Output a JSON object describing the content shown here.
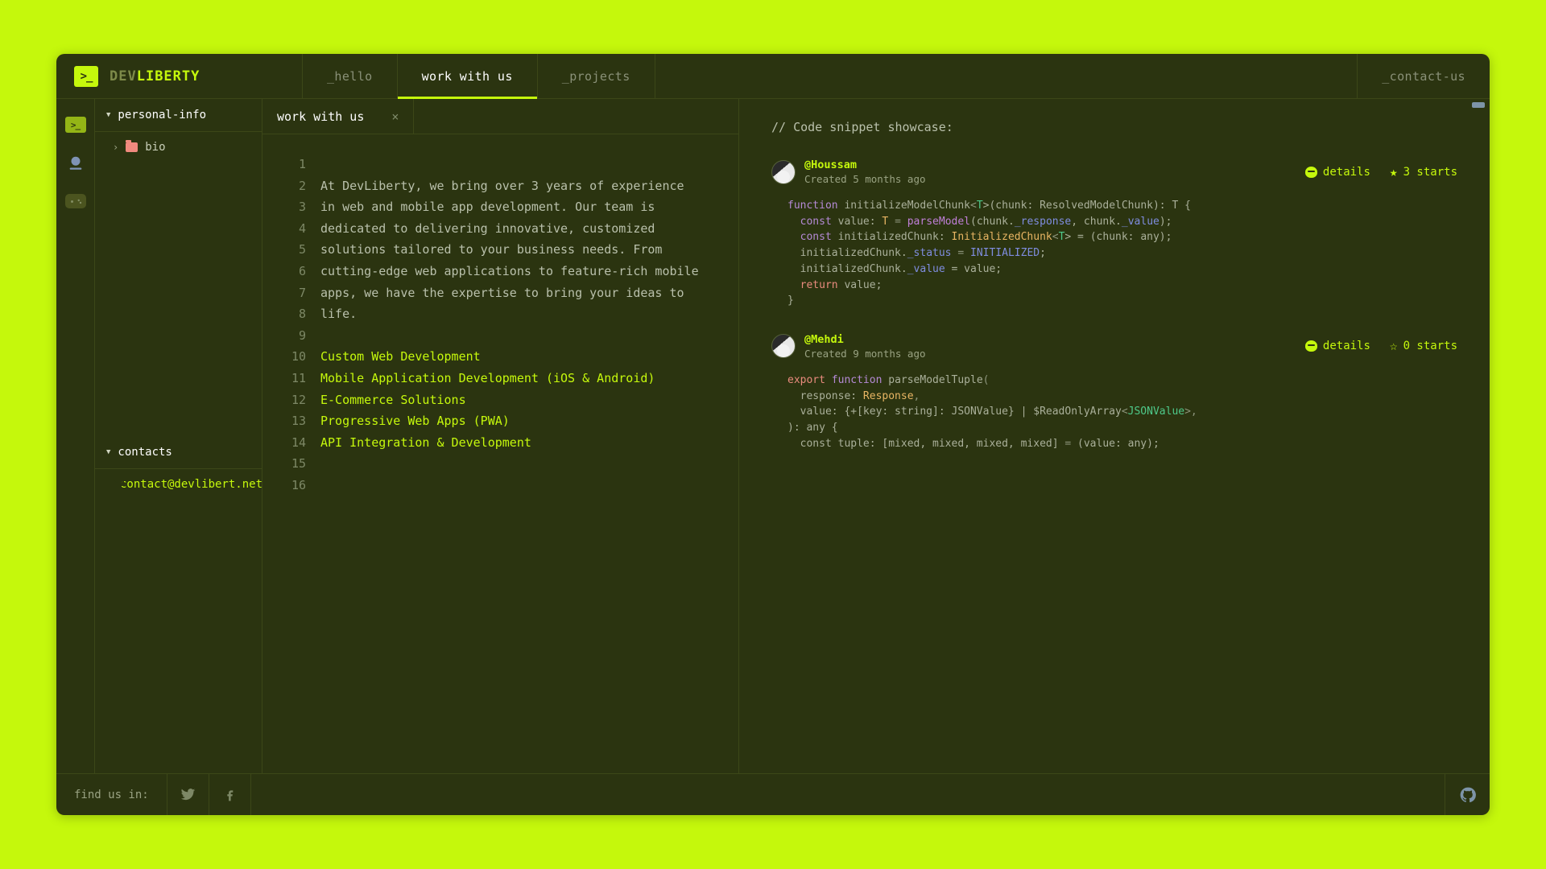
{
  "header": {
    "brand_dim": "DEV",
    "brand_lit": "LIBERTY",
    "logo_glyph": ">_",
    "tabs": [
      {
        "label": "_hello",
        "active": false
      },
      {
        "label": "work with us",
        "active": true
      },
      {
        "label": "_projects",
        "active": false
      }
    ],
    "right_tab": "_contact-us"
  },
  "iconbar": {
    "terminal_glyph": ">_",
    "items": [
      "terminal-icon",
      "user-icon",
      "gamepad-icon"
    ]
  },
  "explorer": {
    "section_personal": "personal-info",
    "item_bio": "bio",
    "section_contacts": "contacts",
    "email": "contact@devlibert.net"
  },
  "editor": {
    "tab_label": "work with us",
    "close_glyph": "×",
    "lines": [
      {
        "n": "1",
        "text": "",
        "highlight": false
      },
      {
        "n": "2",
        "text": "At DevLiberty, we bring over 3 years of experience",
        "highlight": false
      },
      {
        "n": "3",
        "text": "in web and mobile app development. Our team is",
        "highlight": false
      },
      {
        "n": "4",
        "text": "dedicated to delivering innovative, customized",
        "highlight": false
      },
      {
        "n": "5",
        "text": "solutions tailored to your business needs. From",
        "highlight": false
      },
      {
        "n": "6",
        "text": "cutting-edge web applications to feature-rich mobile",
        "highlight": false
      },
      {
        "n": "7",
        "text": "apps, we have the expertise to bring your ideas to",
        "highlight": false
      },
      {
        "n": "8",
        "text": "life.",
        "highlight": false
      },
      {
        "n": "9",
        "text": "",
        "highlight": false
      },
      {
        "n": "10",
        "text": "Custom Web Development",
        "highlight": true
      },
      {
        "n": "11",
        "text": "Mobile Application Development (iOS & Android)",
        "highlight": true
      },
      {
        "n": "12",
        "text": "E-Commerce Solutions",
        "highlight": true
      },
      {
        "n": "13",
        "text": "Progressive Web Apps (PWA)",
        "highlight": true
      },
      {
        "n": "14",
        "text": "API Integration & Development",
        "highlight": true
      },
      {
        "n": "15",
        "text": "",
        "highlight": false
      },
      {
        "n": "16",
        "text": "",
        "highlight": false
      }
    ]
  },
  "snippets": {
    "title": "// Code snippet showcase:",
    "details_label": "details",
    "cards": [
      {
        "user": "@Houssam",
        "created": "Created 5 months ago",
        "stars_label": "3 starts",
        "star_glyph": "★",
        "code": [
          [
            {
              "t": "function ",
              "c": "kw"
            },
            {
              "t": "initializeModelChunk",
              "c": "plain"
            },
            {
              "t": "<",
              "c": "punc"
            },
            {
              "t": "T",
              "c": "gen"
            },
            {
              "t": ">(chunk: ResolvedModelChunk): T {",
              "c": "plain"
            }
          ],
          [
            {
              "t": "  const ",
              "c": "kw"
            },
            {
              "t": "value: ",
              "c": "plain"
            },
            {
              "t": "T",
              "c": "type"
            },
            {
              "t": " = ",
              "c": "punc"
            },
            {
              "t": "parseModel",
              "c": "fn"
            },
            {
              "t": "(chunk.",
              "c": "plain"
            },
            {
              "t": "_response",
              "c": "prop"
            },
            {
              "t": ", chunk.",
              "c": "plain"
            },
            {
              "t": "_value",
              "c": "prop"
            },
            {
              "t": ");",
              "c": "plain"
            }
          ],
          [
            {
              "t": "  const ",
              "c": "kw"
            },
            {
              "t": "initializedChunk: ",
              "c": "plain"
            },
            {
              "t": "InitializedChunk",
              "c": "type"
            },
            {
              "t": "<",
              "c": "punc"
            },
            {
              "t": "T",
              "c": "gen"
            },
            {
              "t": "> = (chunk: any);",
              "c": "plain"
            }
          ],
          [
            {
              "t": "  initializedChunk.",
              "c": "plain"
            },
            {
              "t": "_status",
              "c": "prop"
            },
            {
              "t": " = ",
              "c": "punc"
            },
            {
              "t": "INITIALIZED",
              "c": "prop"
            },
            {
              "t": ";",
              "c": "plain"
            }
          ],
          [
            {
              "t": "  initializedChunk.",
              "c": "plain"
            },
            {
              "t": "_value",
              "c": "prop"
            },
            {
              "t": " = value;",
              "c": "plain"
            }
          ],
          [
            {
              "t": "  return ",
              "c": "kw2"
            },
            {
              "t": "value;",
              "c": "plain"
            }
          ],
          [
            {
              "t": "}",
              "c": "plain"
            }
          ]
        ]
      },
      {
        "user": "@Mehdi",
        "created": "Created 9 months ago",
        "stars_label": "0 starts",
        "star_glyph": "☆",
        "code": [
          [
            {
              "t": "export ",
              "c": "kw2"
            },
            {
              "t": "function ",
              "c": "kw"
            },
            {
              "t": "parseModelTuple",
              "c": "plain"
            },
            {
              "t": "(",
              "c": "punc"
            }
          ],
          [
            {
              "t": "  response: ",
              "c": "plain"
            },
            {
              "t": "Response",
              "c": "type"
            },
            {
              "t": ",",
              "c": "punc"
            }
          ],
          [
            {
              "t": "  value: {+[key: string]: JSONValue} | $ReadOnlyArray",
              "c": "plain"
            },
            {
              "t": "<",
              "c": "punc"
            },
            {
              "t": "JSONValue",
              "c": "gen"
            },
            {
              "t": ">,",
              "c": "punc"
            }
          ],
          [
            {
              "t": "): any {",
              "c": "plain"
            }
          ],
          [
            {
              "t": "  const tuple: [mixed, mixed, mixed, mixed] ",
              "c": "plain"
            },
            {
              "t": "=",
              "c": "punc"
            },
            {
              "t": " (value: any);",
              "c": "plain"
            }
          ]
        ]
      }
    ]
  },
  "footer": {
    "find_label": "find us in:",
    "socials": [
      "twitter-icon",
      "facebook-icon"
    ],
    "github": "github-icon"
  },
  "colors": {
    "page_bg": "#c5f80c",
    "app_bg": "#2b3410",
    "accent": "#c5f80c",
    "border": "#3c4718"
  }
}
